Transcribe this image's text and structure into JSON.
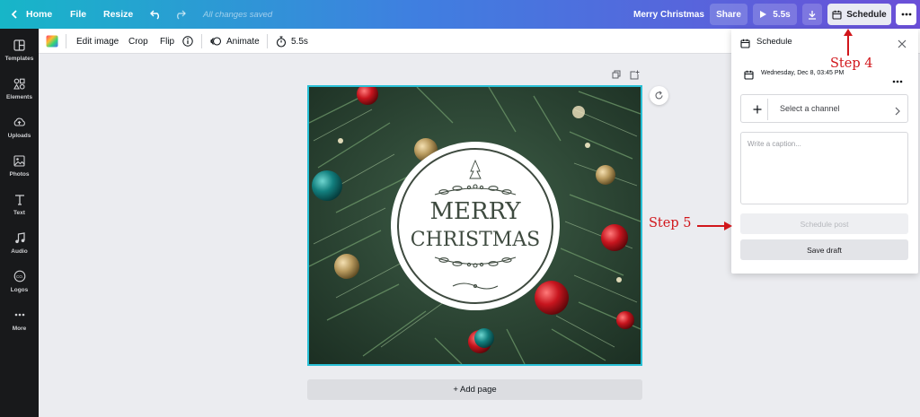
{
  "topbar": {
    "home": "Home",
    "file": "File",
    "resize": "Resize",
    "saved_status": "All changes saved",
    "doc_title": "Merry Christmas",
    "share": "Share",
    "play_duration": "5.5s",
    "schedule": "Schedule"
  },
  "sidebar": {
    "items": [
      {
        "label": "Templates",
        "icon": "templates-icon"
      },
      {
        "label": "Elements",
        "icon": "elements-icon"
      },
      {
        "label": "Uploads",
        "icon": "uploads-icon"
      },
      {
        "label": "Photos",
        "icon": "photos-icon"
      },
      {
        "label": "Text",
        "icon": "text-icon"
      },
      {
        "label": "Audio",
        "icon": "audio-icon"
      },
      {
        "label": "Logos",
        "icon": "logos-icon"
      },
      {
        "label": "More",
        "icon": "more-icon"
      }
    ]
  },
  "toolbar": {
    "edit_image": "Edit image",
    "crop": "Crop",
    "flip": "Flip",
    "animate": "Animate",
    "duration": "5.5s"
  },
  "canvas": {
    "emblem_line1": "MERRY",
    "emblem_line2": "CHRISTMAS",
    "add_page": "+ Add page"
  },
  "schedule_panel": {
    "title": "Schedule",
    "date": "Wednesday, Dec 8, 03:45 PM",
    "channel": "Select a channel",
    "caption_placeholder": "Write a caption...",
    "schedule_post": "Schedule post",
    "save_draft": "Save draft"
  },
  "annotations": {
    "step4": "Step 4",
    "step5": "Step 5",
    "color": "#d1161b"
  },
  "colors": {
    "selection_border": "#29c0d6",
    "sidebar_bg": "#18191b",
    "gradient_start": "#17b6c8",
    "gradient_end": "#6b4fd8"
  }
}
